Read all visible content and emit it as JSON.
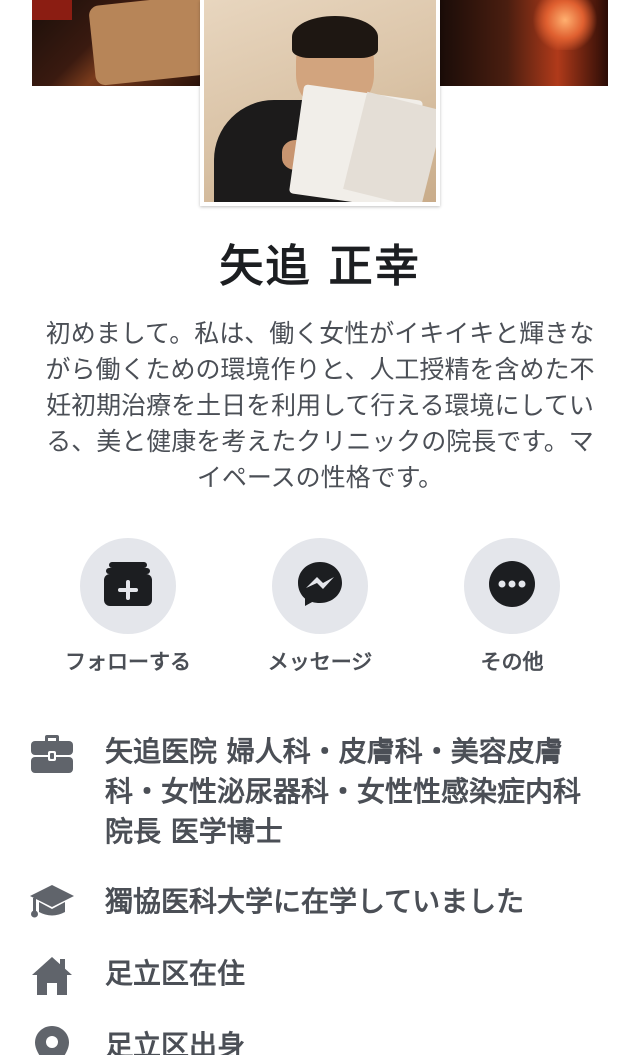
{
  "profile": {
    "name": "矢追 正幸",
    "bio": "初めまして。私は、働く女性がイキイキと輝きながら働くための環境作りと、人工授精を含めた不妊初期治療を土日を利用して行える環境にしている、美と健康を考えたクリニックの院長です。マイペースの性格です。"
  },
  "actions": [
    {
      "label": "フォローする",
      "icon": "follow-icon"
    },
    {
      "label": "メッセージ",
      "icon": "messenger-icon"
    },
    {
      "label": "その他",
      "icon": "more-icon"
    }
  ],
  "info": [
    {
      "icon": "briefcase-icon",
      "text": "矢追医院 婦人科・皮膚科・美容皮膚科・女性泌尿器科・女性性感染症内科 院長 医学博士"
    },
    {
      "icon": "graduation-cap-icon",
      "text": "獨協医科大学に在学していました"
    },
    {
      "icon": "home-icon",
      "text": "足立区在住"
    },
    {
      "icon": "location-pin-icon",
      "text": "足立区出身"
    }
  ],
  "colors": {
    "text_primary": "#1c1e21",
    "text_secondary": "#4b4f56",
    "button_bg": "#e4e6eb",
    "icon_dark": "#1c1e21",
    "icon_gray": "#60646b"
  }
}
